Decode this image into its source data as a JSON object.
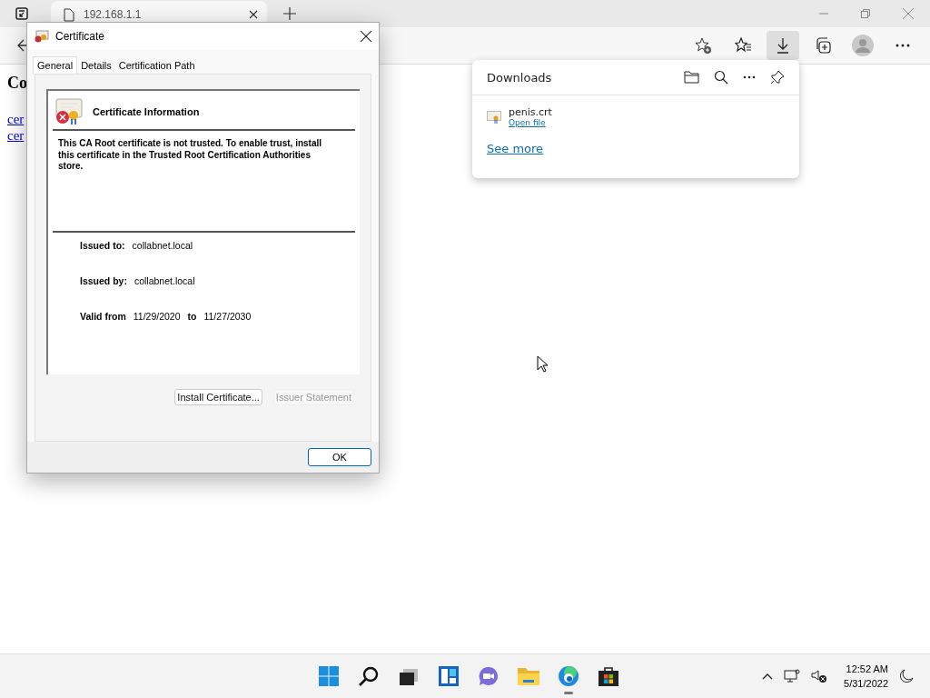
{
  "browser": {
    "tab": {
      "title": "192.168.1.1"
    },
    "toolbar_buttons": [
      {
        "kind": "add-favorite",
        "selected": false
      },
      {
        "kind": "favorites",
        "selected": false
      },
      {
        "kind": "downloads",
        "selected": true
      },
      {
        "kind": "collections",
        "selected": false
      },
      {
        "kind": "profile",
        "selected": false
      },
      {
        "kind": "more",
        "selected": false
      }
    ]
  },
  "page": {
    "heading": "Co",
    "links": [
      "cer",
      "cer"
    ]
  },
  "downloads_panel": {
    "title": "Downloads",
    "items": [
      {
        "name": "penis.crt",
        "action": "Open file"
      }
    ],
    "see_more": "See more"
  },
  "dialog": {
    "title": "Certificate",
    "tabs": [
      {
        "label": "General",
        "selected": true
      },
      {
        "label": "Details",
        "selected": false
      },
      {
        "label": "Certification Path",
        "selected": false
      }
    ],
    "info_title": "Certificate Information",
    "message": "This CA Root certificate is not trusted. To enable trust, install this certificate in the Trusted Root Certification Authorities store.",
    "fields": [
      {
        "label": "Issued to:",
        "value": "collabnet.local"
      },
      {
        "label": "Issued by:",
        "value": "collabnet.local"
      }
    ],
    "validity": {
      "label_from": "Valid from",
      "from": "11/29/2020",
      "label_to": "to",
      "to": "11/27/2030"
    },
    "buttons": [
      {
        "label": "Install Certificate...",
        "disabled": false
      },
      {
        "label": "Issuer Statement",
        "disabled": true
      }
    ],
    "ok": "OK"
  },
  "taskbar": {
    "apps": [
      {
        "kind": "start",
        "running": false
      },
      {
        "kind": "search",
        "running": false
      },
      {
        "kind": "task-view",
        "running": false
      },
      {
        "kind": "widgets",
        "running": false
      },
      {
        "kind": "chat",
        "running": false
      },
      {
        "kind": "explorer",
        "running": false
      },
      {
        "kind": "edge",
        "running": true
      },
      {
        "kind": "store",
        "running": false
      }
    ],
    "clock": {
      "time": "12:52 AM",
      "date": "5/31/2022"
    }
  }
}
